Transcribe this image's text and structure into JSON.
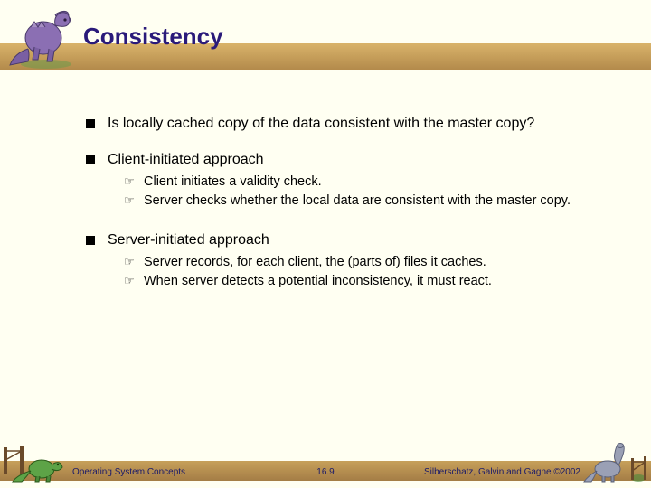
{
  "title": "Consistency",
  "content": {
    "b1": "Is locally cached copy of the data consistent with the master copy?",
    "b2": "Client-initiated approach",
    "b2s": {
      "s1": "Client initiates a validity check.",
      "s2": "Server checks whether the local data are consistent with the master copy."
    },
    "b3": "Server-initiated approach",
    "b3s": {
      "s1": "Server records, for each client, the (parts of) files it caches.",
      "s2": "When server detects a potential inconsistency, it must react."
    }
  },
  "footer": {
    "left": "Operating System Concepts",
    "center": "16.9",
    "right": "Silberschatz, Galvin and  Gagne ©2002"
  }
}
